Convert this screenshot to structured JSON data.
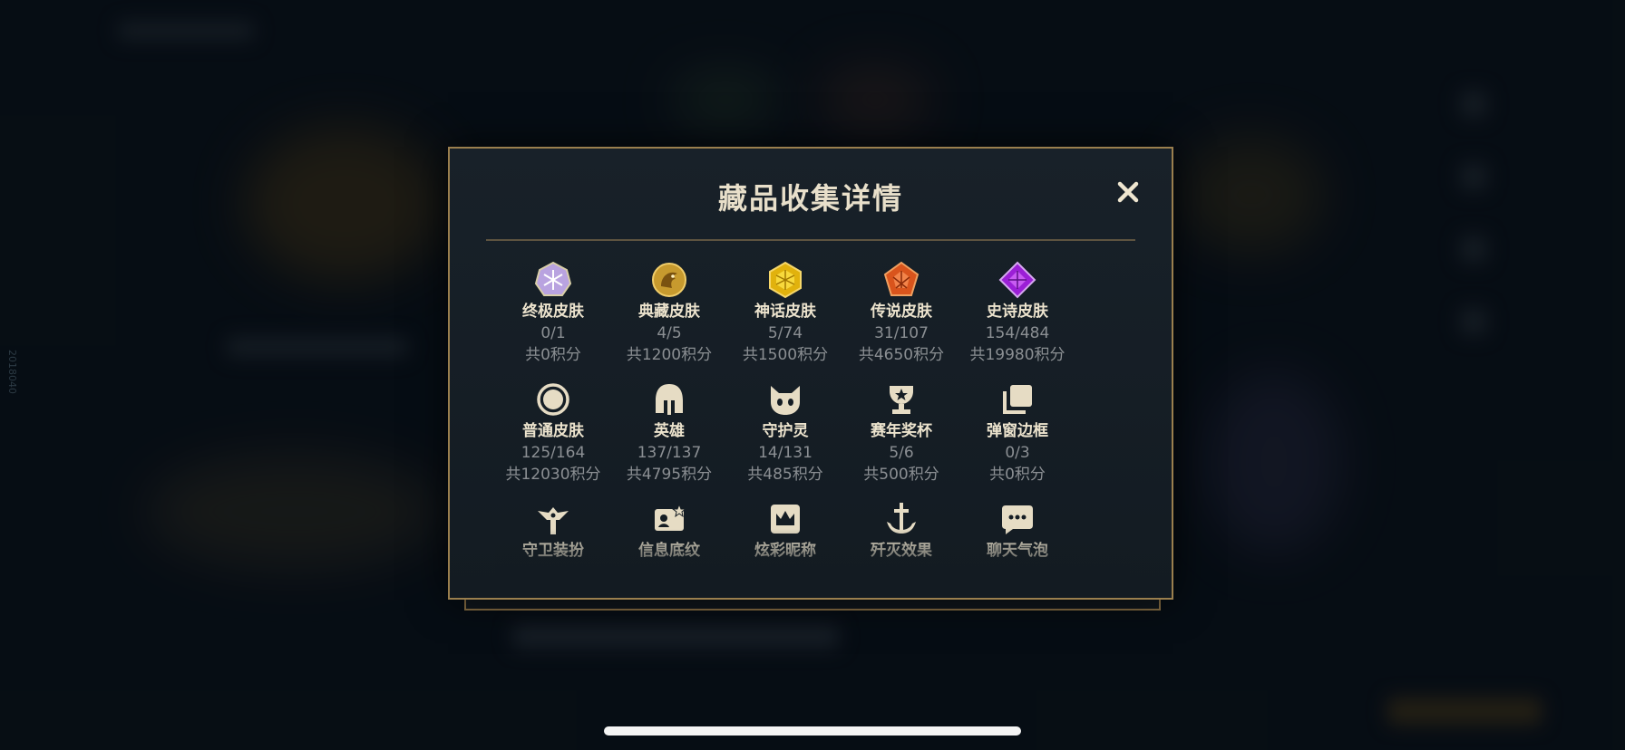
{
  "modal": {
    "title": "藏品收集详情",
    "close_label": "✕"
  },
  "items": [
    {
      "name": "终极皮肤",
      "count": "0/1",
      "points": "共0积分",
      "icon": "ultimate-gem-icon"
    },
    {
      "name": "典藏皮肤",
      "count": "4/5",
      "points": "共1200积分",
      "icon": "dragon-emblem-icon"
    },
    {
      "name": "神话皮肤",
      "count": "5/74",
      "points": "共1500积分",
      "icon": "mythic-gem-icon"
    },
    {
      "name": "传说皮肤",
      "count": "31/107",
      "points": "共4650积分",
      "icon": "legendary-gem-icon"
    },
    {
      "name": "史诗皮肤",
      "count": "154/484",
      "points": "共19980积分",
      "icon": "epic-gem-icon"
    },
    {
      "name": "普通皮肤",
      "count": "125/164",
      "points": "共12030积分",
      "icon": "circle-icon"
    },
    {
      "name": "英雄",
      "count": "137/137",
      "points": "共4795积分",
      "icon": "helmet-icon"
    },
    {
      "name": "守护灵",
      "count": "14/131",
      "points": "共485积分",
      "icon": "little-legend-icon"
    },
    {
      "name": "赛年奖杯",
      "count": "5/6",
      "points": "共500积分",
      "icon": "trophy-icon"
    },
    {
      "name": "弹窗边框",
      "count": "0/3",
      "points": "共0积分",
      "icon": "stacked-cards-icon"
    },
    {
      "name": "守卫装扮",
      "icon": "ward-icon"
    },
    {
      "name": "信息底纹",
      "icon": "banner-icon"
    },
    {
      "name": "炫彩昵称",
      "icon": "crown-frame-icon"
    },
    {
      "name": "歼灭效果",
      "icon": "sword-anchor-icon"
    },
    {
      "name": "聊天气泡",
      "icon": "chat-bubble-icon"
    }
  ],
  "side_tag": "2018040",
  "colors": {
    "gold": "#c8aa6e",
    "cream": "#e8dfca",
    "panel": "#151d24",
    "border": "#9a7f4e"
  }
}
